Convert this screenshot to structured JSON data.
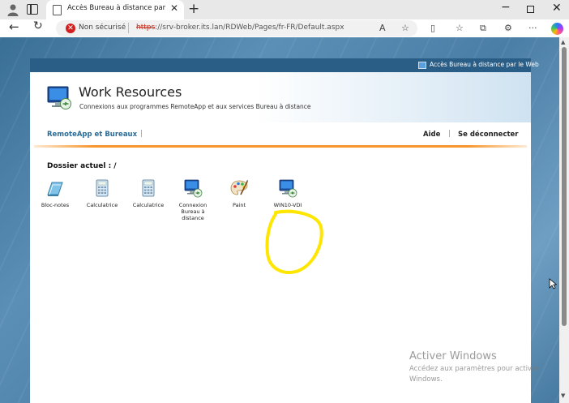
{
  "browser": {
    "tab_title": "Accès Bureau à distance par le W",
    "tab_close": "✕",
    "new_tab": "+",
    "window_min": "−",
    "window_close": "✕",
    "back": "←",
    "reload": "↻",
    "security_label": "Non sécurisé",
    "url_protocol": "https",
    "url_rest": "://srv-broker.its.lan/RDWeb/Pages/fr-FR/Default.aspx",
    "toolbar_icons": [
      "read-aloud-icon",
      "favorite-star-icon",
      "split-screen-icon",
      "favorites-icon",
      "collections-icon",
      "extensions-icon",
      "more-icon",
      "copilot-icon"
    ]
  },
  "page": {
    "topbar_label": "Accès Bureau à distance par le Web",
    "title": "Work Resources",
    "subtitle": "Connexions aux programmes RemoteApp et aux services Bureau à distance",
    "nav": {
      "remoteapp": "RemoteApp et Bureaux",
      "divider": "|",
      "help": "Aide",
      "logout": "Se déconnecter"
    },
    "current_folder": "Dossier actuel : /",
    "apps": [
      {
        "label": "Bloc-notes",
        "icon": "notepad-icon"
      },
      {
        "label": "Calculatrice",
        "icon": "calculator-icon"
      },
      {
        "label": "Calculatrice",
        "icon": "calculator-icon"
      },
      {
        "label": "Connexion Bureau à distance",
        "icon": "remote-desktop-icon"
      },
      {
        "label": "Paint",
        "icon": "paint-icon"
      },
      {
        "label": "WIN10-VDI",
        "icon": "remote-desktop-icon"
      }
    ]
  },
  "watermark": {
    "title": "Activer Windows",
    "subtitle": "Accédez aux paramètres pour activer Windows."
  },
  "colors": {
    "accent_blue": "#2a6b98",
    "topbar": "#2a5e86",
    "orange_line": "#f7962d",
    "highlight_scribble": "#ffe600",
    "insecure_red": "#c42b1c"
  }
}
